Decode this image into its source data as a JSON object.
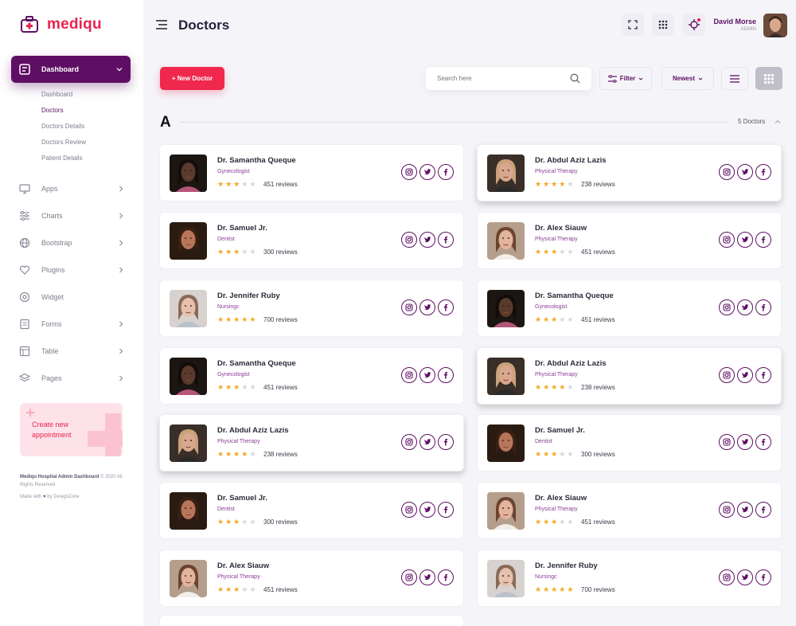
{
  "app": {
    "name": "mediqu",
    "page_title": "Doctors"
  },
  "sidebar": {
    "active": {
      "label": "Dashboard"
    },
    "subitems": [
      {
        "label": "Dashboard",
        "active": false
      },
      {
        "label": "Doctors",
        "active": true
      },
      {
        "label": "Doctors Details",
        "active": false
      },
      {
        "label": "Doctors Review",
        "active": false
      },
      {
        "label": "Patient Details",
        "active": false
      }
    ],
    "items": [
      {
        "label": "Apps",
        "icon": "monitor-icon",
        "chevron": true
      },
      {
        "label": "Charts",
        "icon": "sliders-icon",
        "chevron": true
      },
      {
        "label": "Bootstrap",
        "icon": "globe-icon",
        "chevron": true
      },
      {
        "label": "Plugins",
        "icon": "heart-icon",
        "chevron": true
      },
      {
        "label": "Widget",
        "icon": "widget-icon",
        "chevron": false
      },
      {
        "label": "Forms",
        "icon": "forms-icon",
        "chevron": true
      },
      {
        "label": "Table",
        "icon": "table-icon",
        "chevron": true
      },
      {
        "label": "Pages",
        "icon": "layers-icon",
        "chevron": true
      }
    ],
    "promo": {
      "text": "Create new appointment"
    },
    "footer": {
      "title": "Mediqu Hospital Admin Dashboard",
      "copyright": "© 2020 All Rights Reserved",
      "credit_prefix": "Made with",
      "credit_suffix": "by DesignZone"
    }
  },
  "header": {
    "user_name": "David Morse",
    "user_role": "ADMIN"
  },
  "toolbar": {
    "new_button": "+ New Doctor",
    "search_placeholder": "Search here",
    "filter_label": "Filter",
    "sort_label": "Newest"
  },
  "section": {
    "letter": "A",
    "count": "5 Doctors"
  },
  "colors": {
    "brand": "#5e0f63",
    "accent": "#f0284e",
    "star": "#f5a623",
    "star_empty": "#d6d6de"
  },
  "doctors_left": [
    {
      "name": "Dr. Samantha Queque",
      "specialty": "Gynecologist",
      "rating": 3,
      "reviews": "451 reviews",
      "photo": "dark"
    },
    {
      "name": "Dr. Samuel Jr.",
      "specialty": "Dentist",
      "rating": 3,
      "reviews": "300 reviews",
      "photo": "tan"
    },
    {
      "name": "Dr. Jennifer Ruby",
      "specialty": "Nursingc",
      "rating": 5,
      "reviews": "700 reviews",
      "photo": "light"
    },
    {
      "name": "Dr. Samantha Queque",
      "specialty": "Gynecologist",
      "rating": 3,
      "reviews": "451 reviews",
      "photo": "dark"
    },
    {
      "name": "Dr. Abdul Aziz Lazis",
      "specialty": "Physical Therapy",
      "rating": 4,
      "reviews": "238 reviews",
      "photo": "blonde"
    },
    {
      "name": "Dr. Samuel Jr.",
      "specialty": "Dentist",
      "rating": 3,
      "reviews": "300 reviews",
      "photo": "tan"
    },
    {
      "name": "Dr. Alex Siauw",
      "specialty": "Physical Therapy",
      "rating": 3,
      "reviews": "451 reviews",
      "photo": "brown"
    }
  ],
  "doctors_right": [
    {
      "name": "Dr. Abdul Aziz Lazis",
      "specialty": "Physical Therapy",
      "rating": 4,
      "reviews": "238 reviews",
      "photo": "blonde"
    },
    {
      "name": "Dr. Alex Siauw",
      "specialty": "Physical Therapy",
      "rating": 3,
      "reviews": "451 reviews",
      "photo": "brown"
    },
    {
      "name": "Dr. Samantha Queque",
      "specialty": "Gynecologist",
      "rating": 3,
      "reviews": "451 reviews",
      "photo": "dark"
    },
    {
      "name": "Dr. Abdul Aziz Lazis",
      "specialty": "Physical Therapy",
      "rating": 4,
      "reviews": "238 reviews",
      "photo": "blonde"
    },
    {
      "name": "Dr. Samuel Jr.",
      "specialty": "Dentist",
      "rating": 3,
      "reviews": "300 reviews",
      "photo": "tan"
    },
    {
      "name": "Dr. Alex Siauw",
      "specialty": "Physical Therapy",
      "rating": 3,
      "reviews": "451 reviews",
      "photo": "brown"
    },
    {
      "name": "Dr. Jennifer Ruby",
      "specialty": "Nursingc",
      "rating": 5,
      "reviews": "700 reviews",
      "photo": "light"
    }
  ]
}
